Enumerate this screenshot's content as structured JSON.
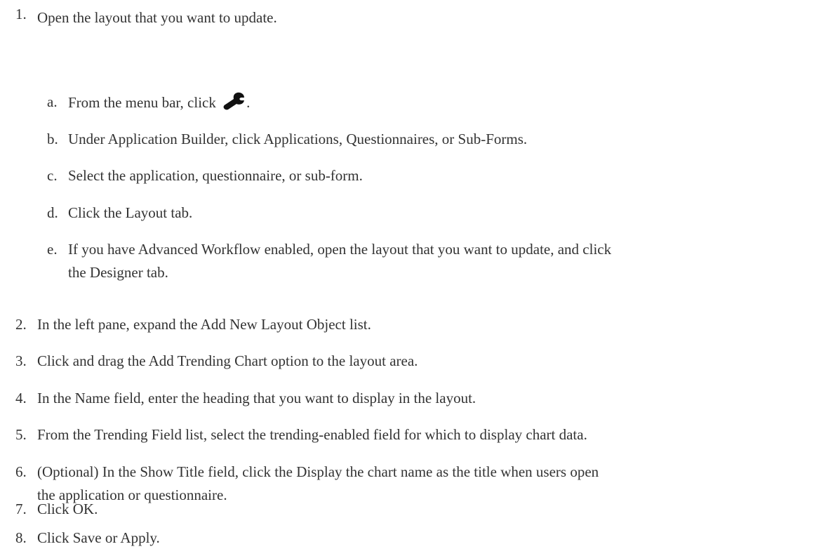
{
  "steps": [
    {
      "number": "1.",
      "text": "Open the layout that you want to update."
    },
    {
      "number": "2.",
      "text": "In the left pane, expand the Add New Layout Object list."
    },
    {
      "number": "3.",
      "text": "Click and drag the Add Trending Chart option to the layout area."
    },
    {
      "number": "4.",
      "text": "In the Name field, enter the heading that you want to display in the layout."
    },
    {
      "number": "5.",
      "text": "From the Trending Field list, select the trending-enabled field for which to display chart data."
    },
    {
      "number": "6.",
      "text_line1": "(Optional) In the Show Title field, click the Display the chart name as the title when users open",
      "text_line2": "the application or questionnaire."
    },
    {
      "number": "7.",
      "text": "Click OK."
    },
    {
      "number": "8.",
      "text": "Click Save or Apply."
    }
  ],
  "substeps": [
    {
      "letter": "a.",
      "text": "From the menu bar, click",
      "icon": "wrench-icon",
      "after_icon": "."
    },
    {
      "letter": "b.",
      "text": "Under Application Builder, click Applications, Questionnaires, or Sub-Forms."
    },
    {
      "letter": "c.",
      "text": "Select the application, questionnaire, or sub-form."
    },
    {
      "letter": "d.",
      "text": "Click the Layout tab."
    },
    {
      "letter": "e.",
      "text_line1": "If you have Advanced Workflow enabled, open the layout that you want to update, and click",
      "text_line2": "the Designer tab."
    }
  ]
}
